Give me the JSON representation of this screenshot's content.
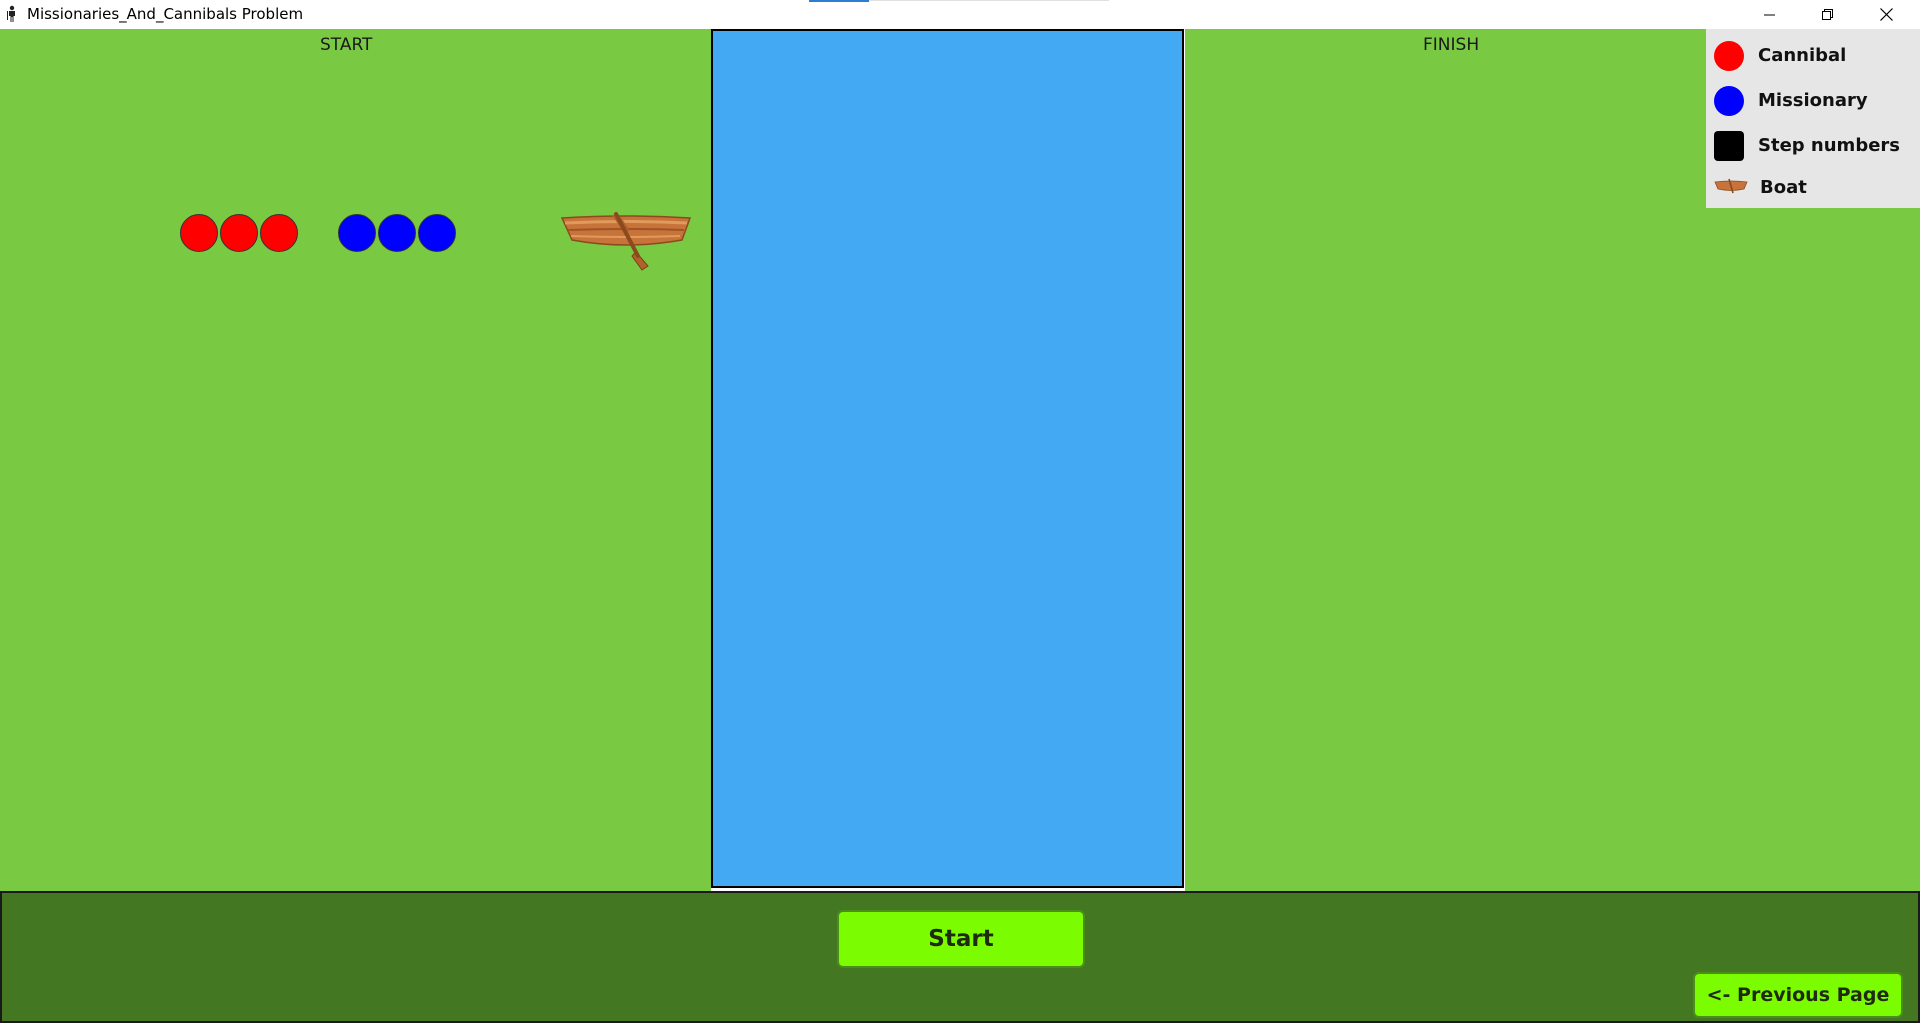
{
  "window": {
    "title": "Missionaries_And_Cannibals Problem"
  },
  "colors": {
    "bank": "#7ac943",
    "river": "#44a9f3",
    "cannibal": "#ff0000",
    "missionary": "#0000ff",
    "step_numbers": "#000000",
    "boat": "#c8733a",
    "bottom_panel": "#437721",
    "button": "#7bfc00",
    "legend_bg": "#e6e6e6",
    "accent": "#2a7fd4"
  },
  "banks": {
    "start_label": "START",
    "finish_label": "FINISH"
  },
  "game_state": {
    "start_bank": {
      "cannibals": 3,
      "missionaries": 3
    },
    "finish_bank": {
      "cannibals": 0,
      "missionaries": 0
    },
    "boat_side": "start"
  },
  "legend": {
    "items": [
      {
        "label": "Cannibal",
        "icon": "red-circle-icon"
      },
      {
        "label": "Missionary",
        "icon": "blue-circle-icon"
      },
      {
        "label": "Step numbers",
        "icon": "black-square-icon"
      },
      {
        "label": "Boat",
        "icon": "boat-icon"
      }
    ]
  },
  "controls": {
    "start_label": "Start",
    "previous_page_label": "<- Previous Page"
  }
}
